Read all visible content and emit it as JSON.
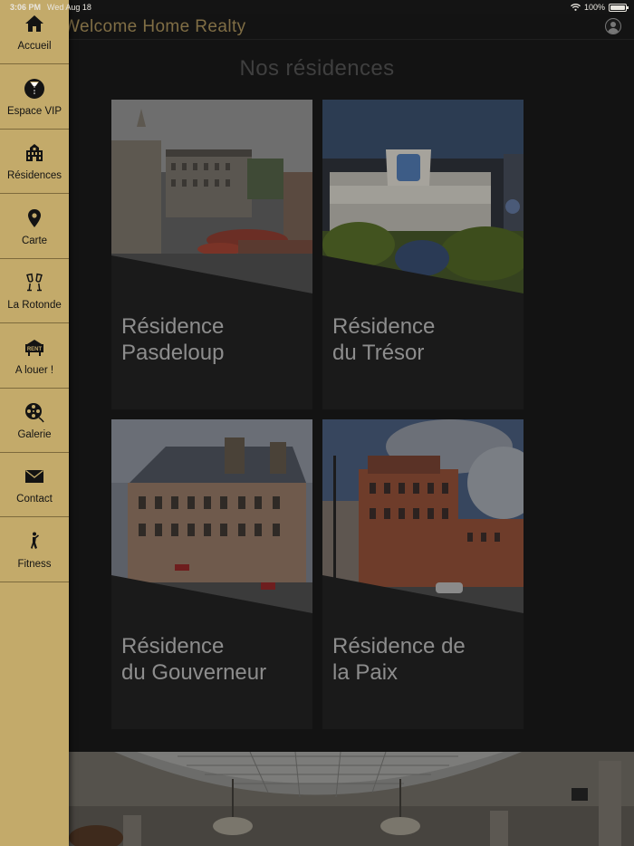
{
  "status_bar": {
    "time": "3:06 PM",
    "date": "Wed Aug 18",
    "battery": "100%",
    "battery_level": 1.0,
    "wifi_icon": "wifi-icon"
  },
  "header": {
    "title": "Welcome Home Realty",
    "profile_icon": "profile-icon"
  },
  "sidebar": {
    "background": "#c3aa6a",
    "items": [
      {
        "label": "Accueil",
        "icon": "home-icon"
      },
      {
        "label": "Espace VIP",
        "icon": "tuxedo-icon"
      },
      {
        "label": "Résidences",
        "icon": "building-icon"
      },
      {
        "label": "Carte",
        "icon": "map-pin-icon"
      },
      {
        "label": "La Rotonde",
        "icon": "champagne-glasses-icon"
      },
      {
        "label": "A louer !",
        "icon": "rent-sign-icon"
      },
      {
        "label": "Galerie",
        "icon": "film-reel-icon"
      },
      {
        "label": "Contact",
        "icon": "envelope-icon"
      },
      {
        "label": "Fitness",
        "icon": "fitness-icon"
      }
    ]
  },
  "main": {
    "page_title": "Nos résidences",
    "residences": [
      {
        "name_line1": "Résidence",
        "name_line2": "Pasdeloup"
      },
      {
        "name_line1": "Résidence",
        "name_line2": "du Trésor"
      },
      {
        "name_line1": "Résidence",
        "name_line2": "du Gouverneur"
      },
      {
        "name_line1": "Résidence de",
        "name_line2": "la Paix"
      }
    ]
  }
}
